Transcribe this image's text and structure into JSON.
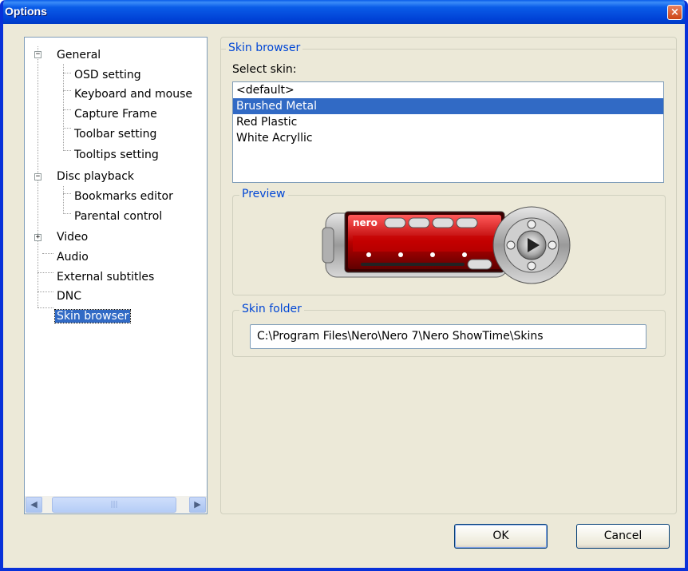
{
  "window": {
    "title": "Options",
    "close_label": "×"
  },
  "tree": {
    "items": [
      {
        "label": "General",
        "expander": "−"
      },
      {
        "label": "OSD setting"
      },
      {
        "label": "Keyboard and mouse"
      },
      {
        "label": "Capture Frame"
      },
      {
        "label": "Toolbar setting"
      },
      {
        "label": "Tooltips setting"
      },
      {
        "label": "Disc playback",
        "expander": "−"
      },
      {
        "label": "Bookmarks editor"
      },
      {
        "label": "Parental control"
      },
      {
        "label": "Video",
        "expander": "+"
      },
      {
        "label": "Audio"
      },
      {
        "label": "External subtitles"
      },
      {
        "label": "DNC"
      },
      {
        "label": "Skin browser",
        "selected": true
      }
    ],
    "scroll_left": "◀",
    "scroll_right": "▶",
    "scroll_thumb": "|||"
  },
  "skin_browser": {
    "legend": "Skin browser",
    "select_label": "Select skin:",
    "skins": [
      "<default>",
      "Brushed Metal",
      "Red Plastic",
      "White Acryllic"
    ],
    "selected_index": 1
  },
  "preview": {
    "legend": "Preview",
    "brand": "nero"
  },
  "skin_folder": {
    "legend": "Skin folder",
    "path": "C:\\Program Files\\Nero\\Nero 7\\Nero ShowTime\\Skins"
  },
  "buttons": {
    "ok": "OK",
    "cancel": "Cancel"
  },
  "colors": {
    "title_bar": "#0a5ce8",
    "accent": "#0046d5",
    "selection": "#316ac5",
    "window_bg": "#ece9d8"
  }
}
